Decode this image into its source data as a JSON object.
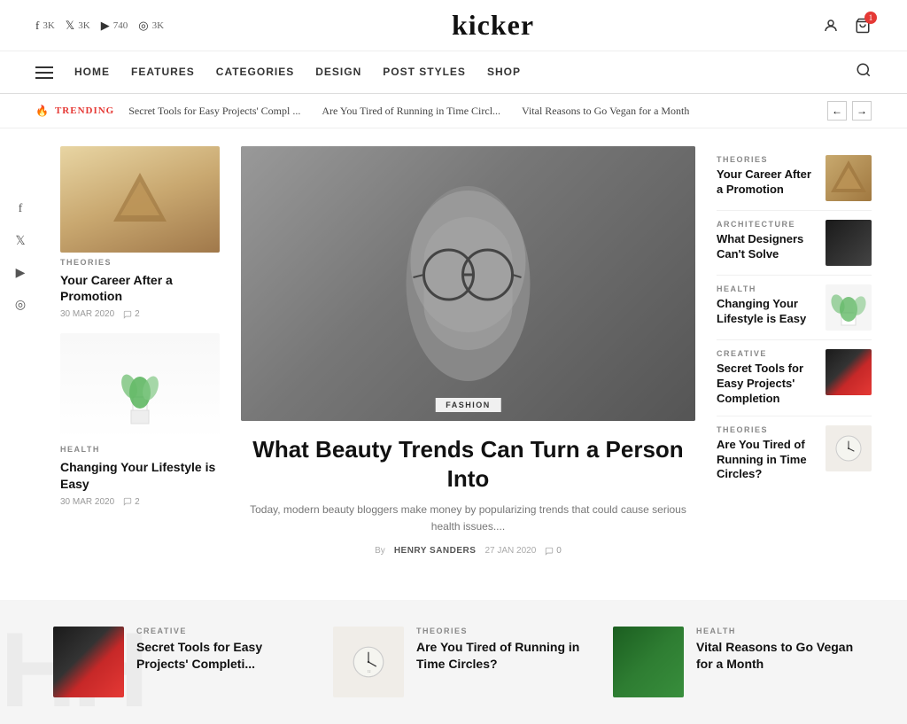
{
  "site": {
    "logo": "kicker"
  },
  "top_bar": {
    "socials": [
      {
        "icon": "f",
        "label": "3K"
      },
      {
        "icon": "𝕏",
        "label": "3K"
      },
      {
        "icon": "▶",
        "label": "740"
      },
      {
        "icon": "📷",
        "label": "3K"
      }
    ],
    "cart_count": "1"
  },
  "nav": {
    "links": [
      "HOME",
      "FEATURES",
      "CATEGORIES",
      "DESIGN",
      "POST STYLES",
      "SHOP"
    ]
  },
  "trending": {
    "label": "TRENDING",
    "items": [
      "Secret Tools for Easy Projects' Compl ...",
      "Are You Tired of Running in Time Circl...",
      "Vital Reasons to Go Vegan for a Month"
    ]
  },
  "left_articles": [
    {
      "category": "THEORIES",
      "title": "Your Career After a Promotion",
      "date": "30 MAR 2020",
      "comments": "2",
      "thumb_type": "triangle"
    },
    {
      "category": "HEALTH",
      "title": "Changing Your Lifestyle is Easy",
      "date": "30 MAR 2020",
      "comments": "2",
      "thumb_type": "plant"
    }
  ],
  "hero": {
    "category": "FASHION",
    "title": "What Beauty Trends Can Turn a Person Into",
    "excerpt": "Today, modern beauty bloggers make money by popularizing trends that could cause serious health issues....",
    "author": "HENRY SANDERS",
    "date": "27 JAN 2020",
    "comments": "0"
  },
  "right_articles": [
    {
      "category": "THEORIES",
      "title": "Your Career After a Promotion",
      "thumb_type": "triangle"
    },
    {
      "category": "ARCHITECTURE",
      "title": "What Designers Can't Solve",
      "thumb_type": "dark"
    },
    {
      "category": "HEALTH",
      "title": "Changing Your Lifestyle is Easy",
      "thumb_type": "plant"
    },
    {
      "category": "CREATIVE",
      "title": "Secret Tools for Easy Projects' Completion",
      "thumb_type": "red"
    },
    {
      "category": "THEORIES",
      "title": "Are You Tired of Running in Time Circles?",
      "thumb_type": "clock"
    }
  ],
  "bottom_cards": [
    {
      "category": "CREATIVE",
      "title": "Secret Tools for Easy Projects' Completi...",
      "thumb_type": "red"
    },
    {
      "category": "THEORIES",
      "title": "Are You Tired of Running in Time Circles?",
      "thumb_type": "clock"
    },
    {
      "category": "HEALTH",
      "title": "Vital Reasons to Go Vegan for a Month",
      "thumb_type": "green"
    }
  ],
  "bottom_bg_text": "HH"
}
